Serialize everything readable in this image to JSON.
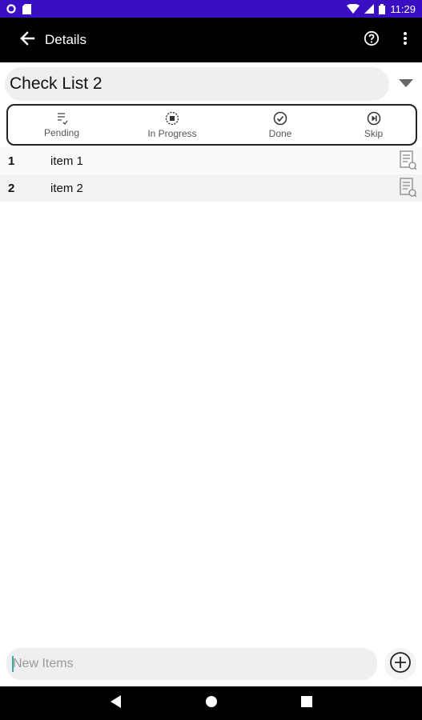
{
  "status_bar": {
    "time": "11:29",
    "background": "#3a0ec2"
  },
  "app_bar": {
    "title": "Details",
    "back_icon": "arrow-back-icon",
    "help_icon": "help-circle-icon",
    "menu_icon": "more-vert-icon"
  },
  "checklist": {
    "selected": "Check List 2"
  },
  "status_filters": [
    {
      "label": "Pending",
      "icon": "pending-icon"
    },
    {
      "label": "In Progress",
      "icon": "in-progress-icon"
    },
    {
      "label": "Done",
      "icon": "done-icon"
    },
    {
      "label": "Skip",
      "icon": "skip-icon"
    }
  ],
  "items": [
    {
      "number": "1",
      "label": "item 1"
    },
    {
      "number": "2",
      "label": "item 2"
    }
  ],
  "new_item": {
    "placeholder": "New Items",
    "value": ""
  }
}
